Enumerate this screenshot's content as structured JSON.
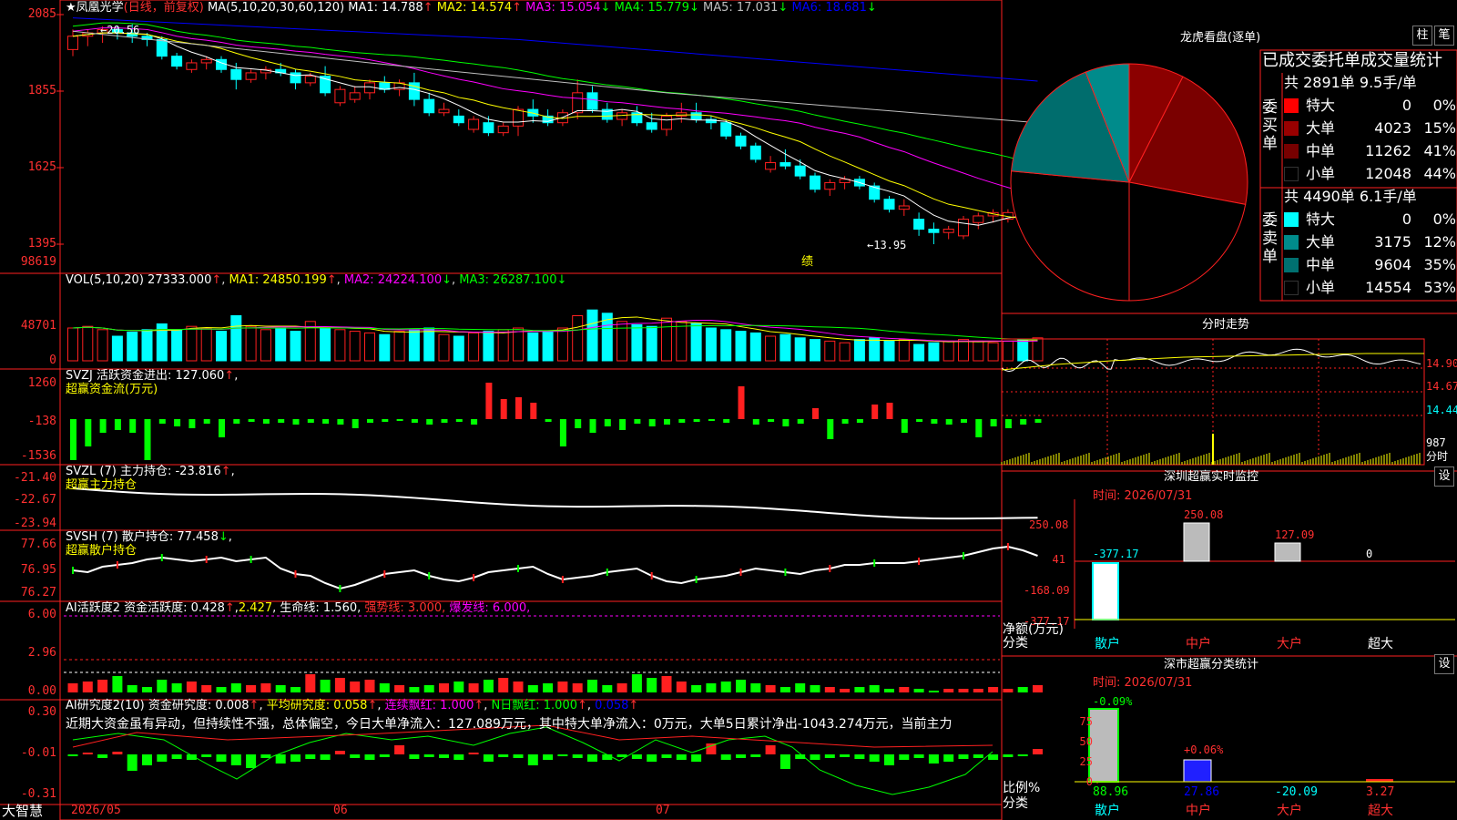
{
  "header": {
    "star": "★",
    "stock_name": "凤凰光学",
    "period": "(日线，前复权)",
    "ma_params": "MA(5,10,20,30,60,120)",
    "ma": [
      {
        "label": "MA1: 14.788",
        "arrow": "↑",
        "color": "#ffffff"
      },
      {
        "label": "MA2: 14.574",
        "arrow": "↑",
        "color": "#ffff00"
      },
      {
        "label": "MA3: 15.054",
        "arrow": "↓",
        "color": "#ff00ff"
      },
      {
        "label": "MA4: 15.779",
        "arrow": "↓",
        "color": "#00ff00"
      },
      {
        "label": "MA5: 17.031",
        "arrow": "↓",
        "color": "#c0c0c0"
      },
      {
        "label": "MA6: 18.681",
        "arrow": "↓",
        "color": "#0000ff"
      }
    ]
  },
  "price_axis": [
    "2085",
    "1855",
    "1625",
    "1395"
  ],
  "price_annotations": {
    "high": "←20.56",
    "low": "←13.95",
    "marker": "绩"
  },
  "volume": {
    "legend": "VOL(5,10,20)",
    "value": "27333.000",
    "arrow": "↑",
    "ma": [
      {
        "label": "MA1: 24850.199",
        "arrow": "↑",
        "color": "#ffff00"
      },
      {
        "label": "MA2: 24224.100",
        "arrow": "↓",
        "color": "#ff00ff"
      },
      {
        "label": "MA3: 26287.100",
        "arrow": "↓",
        "color": "#00ff00"
      }
    ],
    "axis": [
      "98619",
      "48701",
      "0"
    ]
  },
  "svzj": {
    "legend": "SVZJ  活跃资金进出: 127.060",
    "arrow": "↑",
    "sub": "超赢资金流(万元)",
    "axis": [
      "1260",
      "-138",
      "-1536"
    ]
  },
  "svzl": {
    "legend": "SVZL (7) 主力持仓: -23.816",
    "arrow": "↑",
    "sub": "超赢主力持仓",
    "axis": [
      "-21.40",
      "-22.67",
      "-23.94"
    ]
  },
  "svsh": {
    "legend": "SVSH (7) 散户持仓: 77.458",
    "arrow": "↓",
    "sub": "超赢散户持仓",
    "axis": [
      "77.66",
      "76.95",
      "76.27"
    ]
  },
  "ai_active": {
    "legend_a": "AI活跃度2 资金活跃度: 0.428",
    "val2": "2.427",
    "val3": "生命线: 1.560,",
    "strong": "强势线: 3.000,",
    "burst": "爆发线: 6.000,",
    "axis": [
      "6.00",
      "2.96",
      "0.00"
    ]
  },
  "ai_research": {
    "legend": "AI研究度2(10) 资金研究度: 0.008",
    "avg": "平均研究度: 0.058",
    "streak": "连续飘红: 1.000",
    "nday": "N日飘红: 1.000",
    "last": "0.058",
    "comment": "近期大资金虽有异动，但持续性不强，总体偏空，今日大单净流入：127.089万元，其中特大单净流入：0万元，大单5日累计净出-1043.274万元，当前主力",
    "axis": [
      "0.30",
      "-0.01",
      "-0.31"
    ]
  },
  "date_axis": {
    "brand": "大智慧",
    "d1": "2026/05",
    "d2": "06",
    "d3": "07"
  },
  "dragon_tiger": {
    "title": "龙虎看盘(逐单)",
    "btn1": "柱",
    "btn2": "笔",
    "table_title": "已成交委托单成交量统计",
    "buy": {
      "label": "委买单",
      "summary": "共 2891单 9.5手/单",
      "rows": [
        {
          "name": "特大",
          "count": "0",
          "pct": "0%",
          "color": "#ff0000"
        },
        {
          "name": "大单",
          "count": "4023",
          "pct": "15%",
          "color": "#990000"
        },
        {
          "name": "中单",
          "count": "11262",
          "pct": "41%",
          "color": "#770000"
        },
        {
          "name": "小单",
          "count": "12048",
          "pct": "44%",
          "color": "#000000"
        }
      ]
    },
    "sell": {
      "label": "委卖单",
      "summary": "共 4490单 6.1手/单",
      "rows": [
        {
          "name": "特大",
          "count": "0",
          "pct": "0%",
          "color": "#00ffff"
        },
        {
          "name": "大单",
          "count": "3175",
          "pct": "12%",
          "color": "#008b8b"
        },
        {
          "name": "中单",
          "count": "9604",
          "pct": "35%",
          "color": "#007070"
        },
        {
          "name": "小单",
          "count": "14554",
          "pct": "53%",
          "color": "#000000"
        }
      ]
    }
  },
  "intraday": {
    "title": "分时走势",
    "axis": [
      "14.90",
      "14.67",
      "14.44"
    ],
    "vol": "987",
    "vol_unit": "分时"
  },
  "sz_monitor": {
    "title": "深圳超赢实时监控",
    "btn": "设",
    "time": "时间: 2026/07/31",
    "axis": [
      "250.08",
      "41",
      "-168.09",
      "-377.17"
    ],
    "ylabel": "净额(万元)",
    "xlabel": "分类",
    "categories": [
      "散户",
      "中户",
      "大户",
      "超大"
    ],
    "values": [
      "-377.17",
      "250.08",
      "127.09",
      "0"
    ]
  },
  "ss_stats": {
    "title": "深市超赢分类统计",
    "btn": "设",
    "time": "时间: 2026/07/31",
    "axis": [
      "75",
      "50",
      "25",
      "0"
    ],
    "ylabel": "比例%",
    "xlabel": "分类",
    "categories": [
      "散户",
      "中户",
      "大户",
      "超大"
    ],
    "bottom": [
      "88.96",
      "27.86",
      "-20.09",
      "3.27"
    ],
    "top": [
      "-0.09%",
      "+0.06%"
    ]
  },
  "chart_data": [
    {
      "type": "candlestick",
      "title": "凤凰光学 (日线，前复权)",
      "note": "axis labels are x100 of actual price (e.g. 1855 = 18.55)",
      "ohlc": [
        [
          19.8,
          20.4,
          19.6,
          20.2
        ],
        [
          20.2,
          20.4,
          19.9,
          20.3
        ],
        [
          20.3,
          20.5,
          20.0,
          20.4
        ],
        [
          20.4,
          20.5,
          20.1,
          20.3
        ],
        [
          20.3,
          20.56,
          20.0,
          20.2
        ],
        [
          20.2,
          20.3,
          19.9,
          20.1
        ],
        [
          20.1,
          20.2,
          19.5,
          19.6
        ],
        [
          19.6,
          19.7,
          19.2,
          19.3
        ],
        [
          19.2,
          19.5,
          19.1,
          19.4
        ],
        [
          19.4,
          19.6,
          19.2,
          19.5
        ],
        [
          19.5,
          19.6,
          19.1,
          19.2
        ],
        [
          19.2,
          19.4,
          18.6,
          18.9
        ],
        [
          18.9,
          19.2,
          18.8,
          19.1
        ],
        [
          19.1,
          19.3,
          18.9,
          19.2
        ],
        [
          19.2,
          19.4,
          19.0,
          19.1
        ],
        [
          19.1,
          19.2,
          18.6,
          18.8
        ],
        [
          18.8,
          19.1,
          18.7,
          19.0
        ],
        [
          19.0,
          19.3,
          18.4,
          18.5
        ],
        [
          18.2,
          18.7,
          18.1,
          18.6
        ],
        [
          18.3,
          18.7,
          18.2,
          18.5
        ],
        [
          18.5,
          18.9,
          18.3,
          18.8
        ],
        [
          18.8,
          19.0,
          18.5,
          18.6
        ],
        [
          18.6,
          18.9,
          18.4,
          18.8
        ],
        [
          18.8,
          19.1,
          18.1,
          18.3
        ],
        [
          18.3,
          18.5,
          17.8,
          17.9
        ],
        [
          17.9,
          18.2,
          17.8,
          18.0
        ],
        [
          17.8,
          18.0,
          17.5,
          17.6
        ],
        [
          17.4,
          17.8,
          17.3,
          17.7
        ],
        [
          17.6,
          17.8,
          17.2,
          17.3
        ],
        [
          17.3,
          17.6,
          17.2,
          17.5
        ],
        [
          17.5,
          18.1,
          17.2,
          18.0
        ],
        [
          18.0,
          18.3,
          17.6,
          17.8
        ],
        [
          17.8,
          18.0,
          17.5,
          17.6
        ],
        [
          17.6,
          18.0,
          17.5,
          17.9
        ],
        [
          17.9,
          18.9,
          17.7,
          18.5
        ],
        [
          18.5,
          18.7,
          17.9,
          18.0
        ],
        [
          18.0,
          18.2,
          17.6,
          17.7
        ],
        [
          17.7,
          18.0,
          17.5,
          17.9
        ],
        [
          17.9,
          18.1,
          17.5,
          17.6
        ],
        [
          17.6,
          17.9,
          17.3,
          17.4
        ],
        [
          17.4,
          17.9,
          17.2,
          17.8
        ],
        [
          17.8,
          18.2,
          17.6,
          17.9
        ],
        [
          17.9,
          18.2,
          17.6,
          17.7
        ],
        [
          17.7,
          17.8,
          17.4,
          17.6
        ],
        [
          17.6,
          17.7,
          17.1,
          17.2
        ],
        [
          17.2,
          17.3,
          16.8,
          16.9
        ],
        [
          16.9,
          17.0,
          16.4,
          16.5
        ],
        [
          16.2,
          16.6,
          16.1,
          16.4
        ],
        [
          16.4,
          16.8,
          16.2,
          16.3
        ],
        [
          16.3,
          16.5,
          15.9,
          16.0
        ],
        [
          16.0,
          16.1,
          15.5,
          15.6
        ],
        [
          15.6,
          15.9,
          15.4,
          15.8
        ],
        [
          15.8,
          16.0,
          15.6,
          15.9
        ],
        [
          15.9,
          16.0,
          15.6,
          15.7
        ],
        [
          15.7,
          15.8,
          15.2,
          15.3
        ],
        [
          15.3,
          15.4,
          14.9,
          15.0
        ],
        [
          15.0,
          15.3,
          14.8,
          15.1
        ],
        [
          14.7,
          14.9,
          14.2,
          14.4
        ],
        [
          14.4,
          14.6,
          13.95,
          14.3
        ],
        [
          14.3,
          14.5,
          14.1,
          14.4
        ],
        [
          14.2,
          14.8,
          14.1,
          14.7
        ],
        [
          14.6,
          14.9,
          14.4,
          14.8
        ],
        [
          14.8,
          15.0,
          14.6,
          14.9
        ],
        [
          14.7,
          15.0,
          14.6,
          14.9
        ],
        [
          14.9,
          15.0,
          14.5,
          14.7
        ],
        [
          14.7,
          15.1,
          14.6,
          14.9
        ]
      ],
      "x_labels": [
        "2026/05",
        "06",
        "07"
      ],
      "y_ticks": [
        2085,
        1855,
        1625,
        1395
      ]
    },
    {
      "type": "bar",
      "title": "VOL(5,10,20)",
      "y_ticks": [
        98619,
        48701,
        0
      ]
    }
  ]
}
